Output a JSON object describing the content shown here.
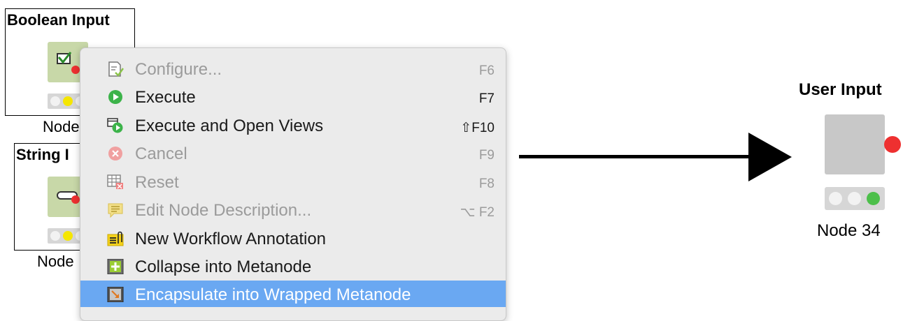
{
  "left_nodes": {
    "boolean": {
      "title": "Boolean Input",
      "label": "Node"
    },
    "string": {
      "title": "String I",
      "label": "Node"
    }
  },
  "context_menu": {
    "items": [
      {
        "label": "Configure...",
        "shortcut": "F6",
        "icon": "configure-icon",
        "disabled": true
      },
      {
        "label": "Execute",
        "shortcut": "F7",
        "icon": "execute-icon",
        "disabled": false
      },
      {
        "label": "Execute and Open Views",
        "shortcut": "⇧F10",
        "icon": "execute-open-views-icon",
        "disabled": false
      },
      {
        "label": "Cancel",
        "shortcut": "F9",
        "icon": "cancel-icon",
        "disabled": true
      },
      {
        "label": "Reset",
        "shortcut": "F8",
        "icon": "reset-icon",
        "disabled": true
      },
      {
        "label": "Edit Node Description...",
        "shortcut": "⌥ F2",
        "icon": "edit-description-icon",
        "disabled": true
      },
      {
        "label": "New Workflow Annotation",
        "shortcut": "",
        "icon": "annotation-icon",
        "disabled": false
      },
      {
        "label": "Collapse into Metanode",
        "shortcut": "",
        "icon": "collapse-metanode-icon",
        "disabled": false
      },
      {
        "label": "Encapsulate into Wrapped Metanode",
        "shortcut": "",
        "icon": "wrap-metanode-icon",
        "disabled": false,
        "highlighted": true
      }
    ]
  },
  "result_node": {
    "title": "User Input",
    "label": "Node 34"
  },
  "colors": {
    "menu_highlight": "#6aa8f2",
    "node_icon_green": "#c8d8a8",
    "status_green": "#4cbf4a",
    "status_red": "#ee3030",
    "status_yellow": "#f5e600"
  }
}
